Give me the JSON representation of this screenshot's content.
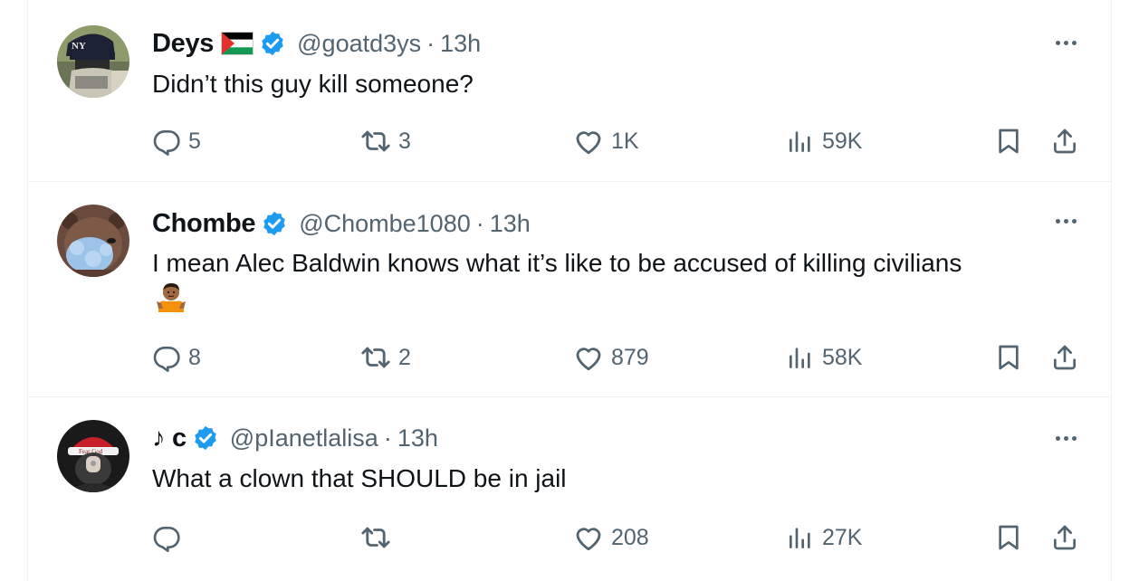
{
  "tweets": [
    {
      "name": "Deys",
      "handle": "@goatd3ys",
      "time": "13h",
      "text": "Didn’t this guy kill someone?",
      "has_flag": true,
      "verified": true,
      "replies": "5",
      "reposts": "3",
      "likes": "1K",
      "views": "59K"
    },
    {
      "name": "Chombe",
      "handle": "@Chombe1080",
      "time": "13h",
      "text": "I mean Alec Baldwin knows what it’s like to be accused of killing civilians",
      "emoji": "person-shrugging-emoji",
      "verified": true,
      "replies": "8",
      "reposts": "2",
      "likes": "879",
      "views": "58K"
    },
    {
      "name": "♪ c",
      "handle": "@pIanetlalisa",
      "time": "13h",
      "text": "What a clown that SHOULD be in jail",
      "verified": true,
      "replies": "",
      "reposts": "",
      "likes": "208",
      "views": "27K"
    }
  ],
  "separator": "·",
  "colors": {
    "verified_badge": "#1d9bf0",
    "secondary_text": "#536471",
    "primary_text": "#0f1419",
    "divider": "#eff3f4"
  },
  "icons": [
    "reply-icon",
    "repost-icon",
    "like-icon",
    "views-icon",
    "bookmark-icon",
    "share-icon",
    "more-icon",
    "verified-badge-icon",
    "palestine-flag-icon"
  ]
}
